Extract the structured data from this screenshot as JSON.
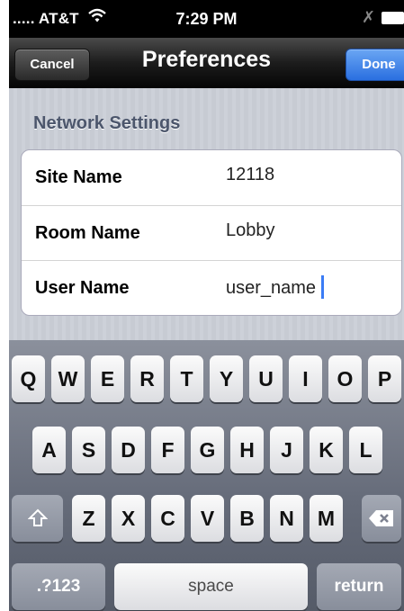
{
  "status_bar": {
    "carrier": "..... AT&T",
    "time": "7:29 PM"
  },
  "nav": {
    "title": "Preferences",
    "cancel_label": "Cancel",
    "done_label": "Done"
  },
  "section_header": "Network Settings",
  "fields": [
    {
      "label": "Site Name",
      "value": "12118"
    },
    {
      "label": "Room Name",
      "value": "Lobby"
    },
    {
      "label": "User Name",
      "value": "user_name"
    }
  ],
  "keyboard": {
    "row1": [
      "Q",
      "W",
      "E",
      "R",
      "T",
      "Y",
      "U",
      "I",
      "O",
      "P"
    ],
    "row2": [
      "A",
      "S",
      "D",
      "F",
      "G",
      "H",
      "J",
      "K",
      "L"
    ],
    "row3": [
      "Z",
      "X",
      "C",
      "V",
      "B",
      "N",
      "M"
    ],
    "numbers_label": ".?123",
    "space_label": "space",
    "return_label": "return"
  },
  "icons": [
    "wifi-icon",
    "bluetooth-icon",
    "battery-icon",
    "shift-icon",
    "backspace-icon"
  ],
  "colors": {
    "done_button": "#2a6fe0",
    "section_header": "#4c566c",
    "caret": "#3b7cf5"
  }
}
